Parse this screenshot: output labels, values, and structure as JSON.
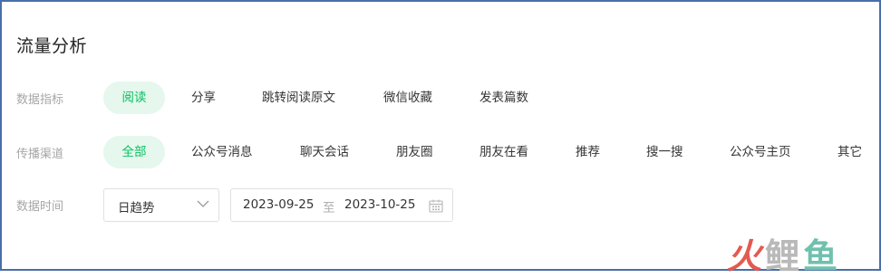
{
  "title": "流量分析",
  "rows": {
    "metric": {
      "label": "数据指标",
      "options": [
        "阅读",
        "分享",
        "跳转阅读原文",
        "微信收藏",
        "发表篇数"
      ],
      "selected": "阅读"
    },
    "channel": {
      "label": "传播渠道",
      "options": [
        "全部",
        "公众号消息",
        "聊天会话",
        "朋友圈",
        "朋友在看",
        "推荐",
        "搜一搜",
        "公众号主页",
        "其它"
      ],
      "selected": "全部"
    },
    "time": {
      "label": "数据时间",
      "granularity": "日趋势",
      "start_date": "2023-09-25",
      "range_separator": "至",
      "end_date": "2023-10-25"
    }
  },
  "watermark": {
    "char1": "火",
    "char2": "鲤",
    "char3": "鱼"
  },
  "colors": {
    "accent": "#07c160",
    "accent_bg": "#e6f7ed",
    "border": "#4a6fa8"
  }
}
